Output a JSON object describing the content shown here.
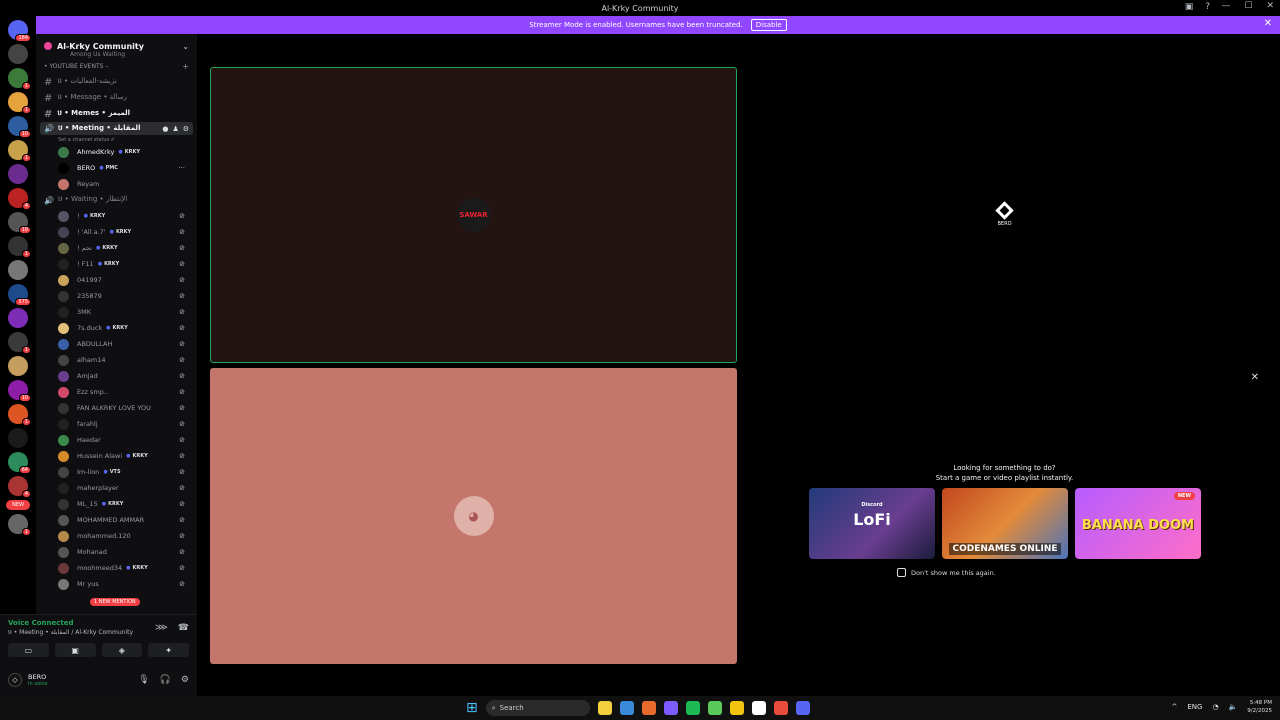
{
  "window": {
    "title": "Al-Krky Community"
  },
  "banner": {
    "text": "Streamer Mode is enabled. Usernames have been truncated.",
    "disable_label": "Disable",
    "close": "✕"
  },
  "guilds": [
    {
      "color": "#5865f2",
      "badge": "184"
    },
    {
      "color": "#444",
      "badge": ""
    },
    {
      "color": "#3b7a3b",
      "badge": "1"
    },
    {
      "color": "#e6a23c",
      "badge": "1"
    },
    {
      "color": "#2d5d9f",
      "badge": "10"
    },
    {
      "color": "#c8a24a",
      "badge": "1"
    },
    {
      "color": "#6b2c8f",
      "badge": ""
    },
    {
      "color": "#b22",
      "badge": "4"
    },
    {
      "color": "#555",
      "badge": "19"
    },
    {
      "color": "#333",
      "badge": "1"
    },
    {
      "color": "#777",
      "badge": ""
    },
    {
      "color": "#1d4a8a",
      "badge": "575"
    },
    {
      "color": "#7d2db5",
      "badge": ""
    },
    {
      "color": "#3a3a3a",
      "badge": "1"
    },
    {
      "color": "#c59d5f",
      "badge": ""
    },
    {
      "color": "#8e1ea8",
      "badge": "10"
    },
    {
      "color": "#d52",
      "badge": "1"
    },
    {
      "color": "#1a1a1a",
      "badge": ""
    },
    {
      "color": "#2c8c5c",
      "badge": "64"
    },
    {
      "color": "#a33",
      "badge": "4"
    },
    {
      "color": "#666",
      "badge": "1"
    }
  ],
  "guild_new": "NEW",
  "server": {
    "name": "Al-Krky Community",
    "chevron": "⌄"
  },
  "channels": {
    "top_partial": "Among Us Waiting",
    "category": "• YOUTUBE EVENTS –",
    "cat_plus": "+",
    "items": [
      {
        "name": "ឞ • نزيشه-الفعاليات",
        "style": ""
      },
      {
        "name": "ឞ • Message • رسالة",
        "style": ""
      },
      {
        "name": "ឞ • Memes • الميمز",
        "style": "white"
      }
    ],
    "active": {
      "name": "ឞ • Meeting • المقابلة",
      "status": "Set a channel status ✐"
    },
    "waiting": "ឞ • Waiting • الإنتظار"
  },
  "meeting_users": [
    {
      "name": "AhmedKrky",
      "tag": "KRKY",
      "color": "#3a7a4a",
      "bright": true
    },
    {
      "name": "BERO",
      "tag": "PMC",
      "color": "#000",
      "bright": true,
      "more": "···"
    },
    {
      "name": "Reyam",
      "tag": "",
      "color": "#c4766c",
      "bright": false
    }
  ],
  "waiting_users": [
    {
      "name": "!",
      "tag": "KRKY",
      "color": "#556"
    },
    {
      "name": "! 'All.a.7'",
      "tag": "KRKY",
      "color": "#445"
    },
    {
      "name": "! نجم",
      "tag": "KRKY",
      "color": "#664"
    },
    {
      "name": "! F11",
      "tag": "KRKY",
      "color": "#222"
    },
    {
      "name": "041997",
      "tag": "",
      "color": "#c9a45a"
    },
    {
      "name": "235879",
      "tag": "",
      "color": "#333"
    },
    {
      "name": "3MK",
      "tag": "",
      "color": "#222"
    },
    {
      "name": "7s.duck",
      "tag": "KRKY",
      "color": "#e3c07a"
    },
    {
      "name": "ABDULLAH",
      "tag": "",
      "color": "#3a5fa8"
    },
    {
      "name": "alham14",
      "tag": "",
      "color": "#444"
    },
    {
      "name": "Amjad",
      "tag": "",
      "color": "#6b3d8f"
    },
    {
      "name": "Ezz smp..",
      "tag": "",
      "color": "#d14a6a"
    },
    {
      "name": "FAN ALKRKY LOVE YOU",
      "tag": "",
      "color": "#333"
    },
    {
      "name": "farahlj",
      "tag": "",
      "color": "#222"
    },
    {
      "name": "Haedar",
      "tag": "",
      "color": "#3a8a4a"
    },
    {
      "name": "Hussein Alawi",
      "tag": "KRKY",
      "color": "#d68a2a"
    },
    {
      "name": "Im-lion",
      "tag": "VTS",
      "color": "#444"
    },
    {
      "name": "maherplayer",
      "tag": "",
      "color": "#222"
    },
    {
      "name": "ML_15",
      "tag": "KRKY",
      "color": "#333"
    },
    {
      "name": "MOHAMMED AMMAR",
      "tag": "",
      "color": "#555"
    },
    {
      "name": "mohammed.120",
      "tag": "",
      "color": "#b68a4a"
    },
    {
      "name": "Mohanad",
      "tag": "",
      "color": "#555"
    },
    {
      "name": "moohmeed34",
      "tag": "KRKY",
      "color": "#6a3a3a"
    },
    {
      "name": "Mr yus",
      "tag": "",
      "color": "#777"
    }
  ],
  "mention_pill": "1 NEW MENTION",
  "voice": {
    "status": "Voice Connected",
    "channel": "ឞ • Meeting • المقابلة / Al-Krky Community"
  },
  "user_panel": {
    "name": "BERO",
    "status": "In voice"
  },
  "tiles": {
    "tile1_text": "SAWAR",
    "tile3_name": "BERO"
  },
  "activity": {
    "prompt_line1": "Looking for something to do?",
    "prompt_line2": "Start a game or video playlist instantly.",
    "cards": [
      {
        "kind": "lofi",
        "small": "Discord",
        "title": "LoFi"
      },
      {
        "kind": "code",
        "title": "CODENAMES ONLINE"
      },
      {
        "kind": "banana",
        "title": "BANANA DOOM",
        "badge": "NEW"
      }
    ],
    "dont_show": "Don't show me this again."
  },
  "taskbar": {
    "search": "Search",
    "lang": "ENG",
    "time": "5:48 PM",
    "date": "9/2/2025",
    "apps": [
      "#f4d03f",
      "#3b8ad9",
      "#e86a2c",
      "#7d5cff",
      "#1db954",
      "#5ac85a",
      "#f1c40f",
      "#ffffff",
      "#e74c3c",
      "#5865f2"
    ]
  }
}
